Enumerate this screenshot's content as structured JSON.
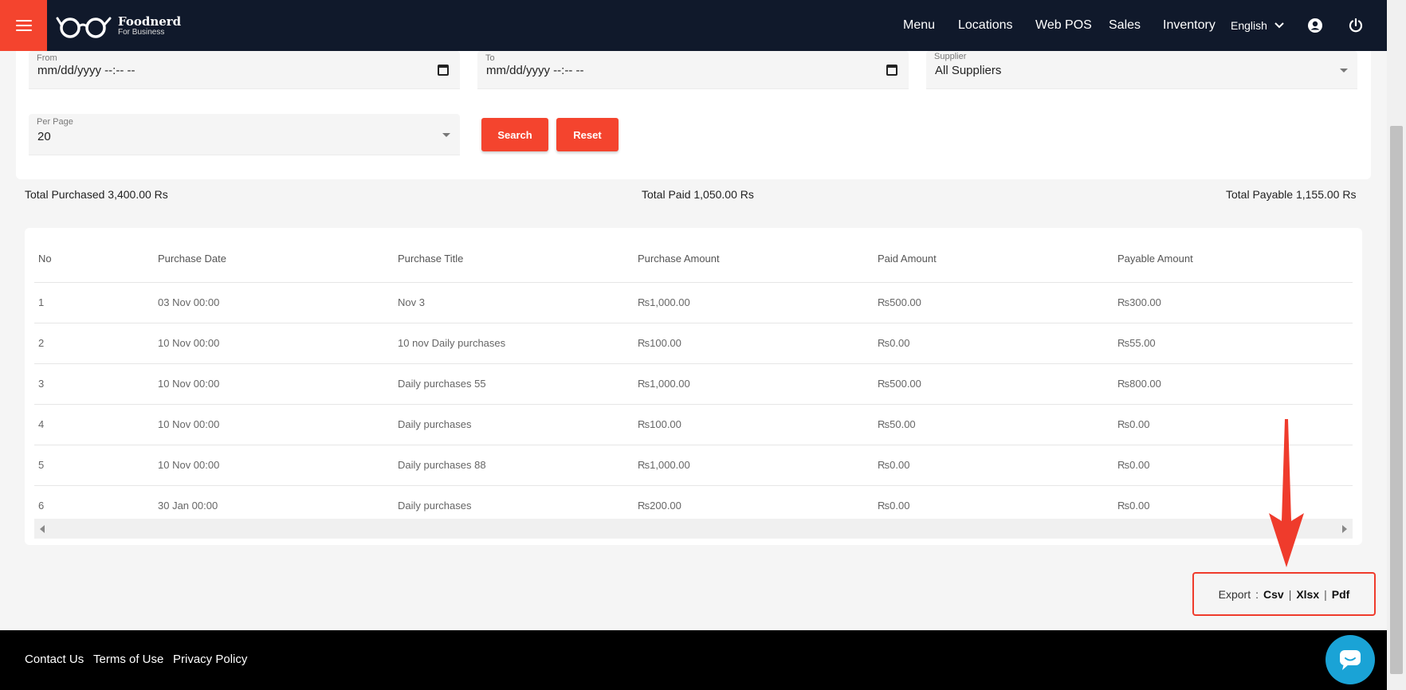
{
  "header": {
    "logo_name": "Foodnerd",
    "logo_sub": "For Business",
    "nav": [
      "Menu",
      "Locations",
      "Web POS",
      "Sales",
      "Inventory"
    ],
    "language": "English"
  },
  "filters": {
    "from_label": "From",
    "from_value": "mm/dd/yyyy --:-- --",
    "to_label": "To",
    "to_value": "mm/dd/yyyy --:-- --",
    "supplier_label": "Supplier",
    "supplier_value": "All Suppliers",
    "per_page_label": "Per Page",
    "per_page_value": "20",
    "search_label": "Search",
    "reset_label": "Reset"
  },
  "totals": {
    "purchased": "Total Purchased 3,400.00 Rs",
    "paid": "Total Paid 1,050.00 Rs",
    "payable": "Total Payable 1,155.00 Rs"
  },
  "table": {
    "headers": [
      "No",
      "Purchase Date",
      "Purchase Title",
      "Purchase Amount",
      "Paid Amount",
      "Payable Amount"
    ],
    "rows": [
      [
        "1",
        "03 Nov 00:00",
        "Nov 3",
        "₨1,000.00",
        "₨500.00",
        "₨300.00"
      ],
      [
        "2",
        "10 Nov 00:00",
        "10 nov Daily purchases",
        "₨100.00",
        "₨0.00",
        "₨55.00"
      ],
      [
        "3",
        "10 Nov 00:00",
        "Daily purchases 55",
        "₨1,000.00",
        "₨500.00",
        "₨800.00"
      ],
      [
        "4",
        "10 Nov 00:00",
        "Daily purchases",
        "₨100.00",
        "₨50.00",
        "₨0.00"
      ],
      [
        "5",
        "10 Nov 00:00",
        "Daily purchases 88",
        "₨1,000.00",
        "₨0.00",
        "₨0.00"
      ],
      [
        "6",
        "30 Jan 00:00",
        "Daily purchases",
        "₨200.00",
        "₨0.00",
        "₨0.00"
      ]
    ]
  },
  "export": {
    "label": "Export",
    "colon": ":",
    "csv": "Csv",
    "xlsx": "Xlsx",
    "pdf": "Pdf",
    "sep": "|"
  },
  "footer": {
    "contact": "Contact Us",
    "terms": "Terms of Use",
    "privacy": "Privacy Policy"
  },
  "colors": {
    "accent": "#f4442e",
    "nav_bg": "#10192b",
    "annotation": "#ef3b2c",
    "chat": "#1aa3d6"
  }
}
